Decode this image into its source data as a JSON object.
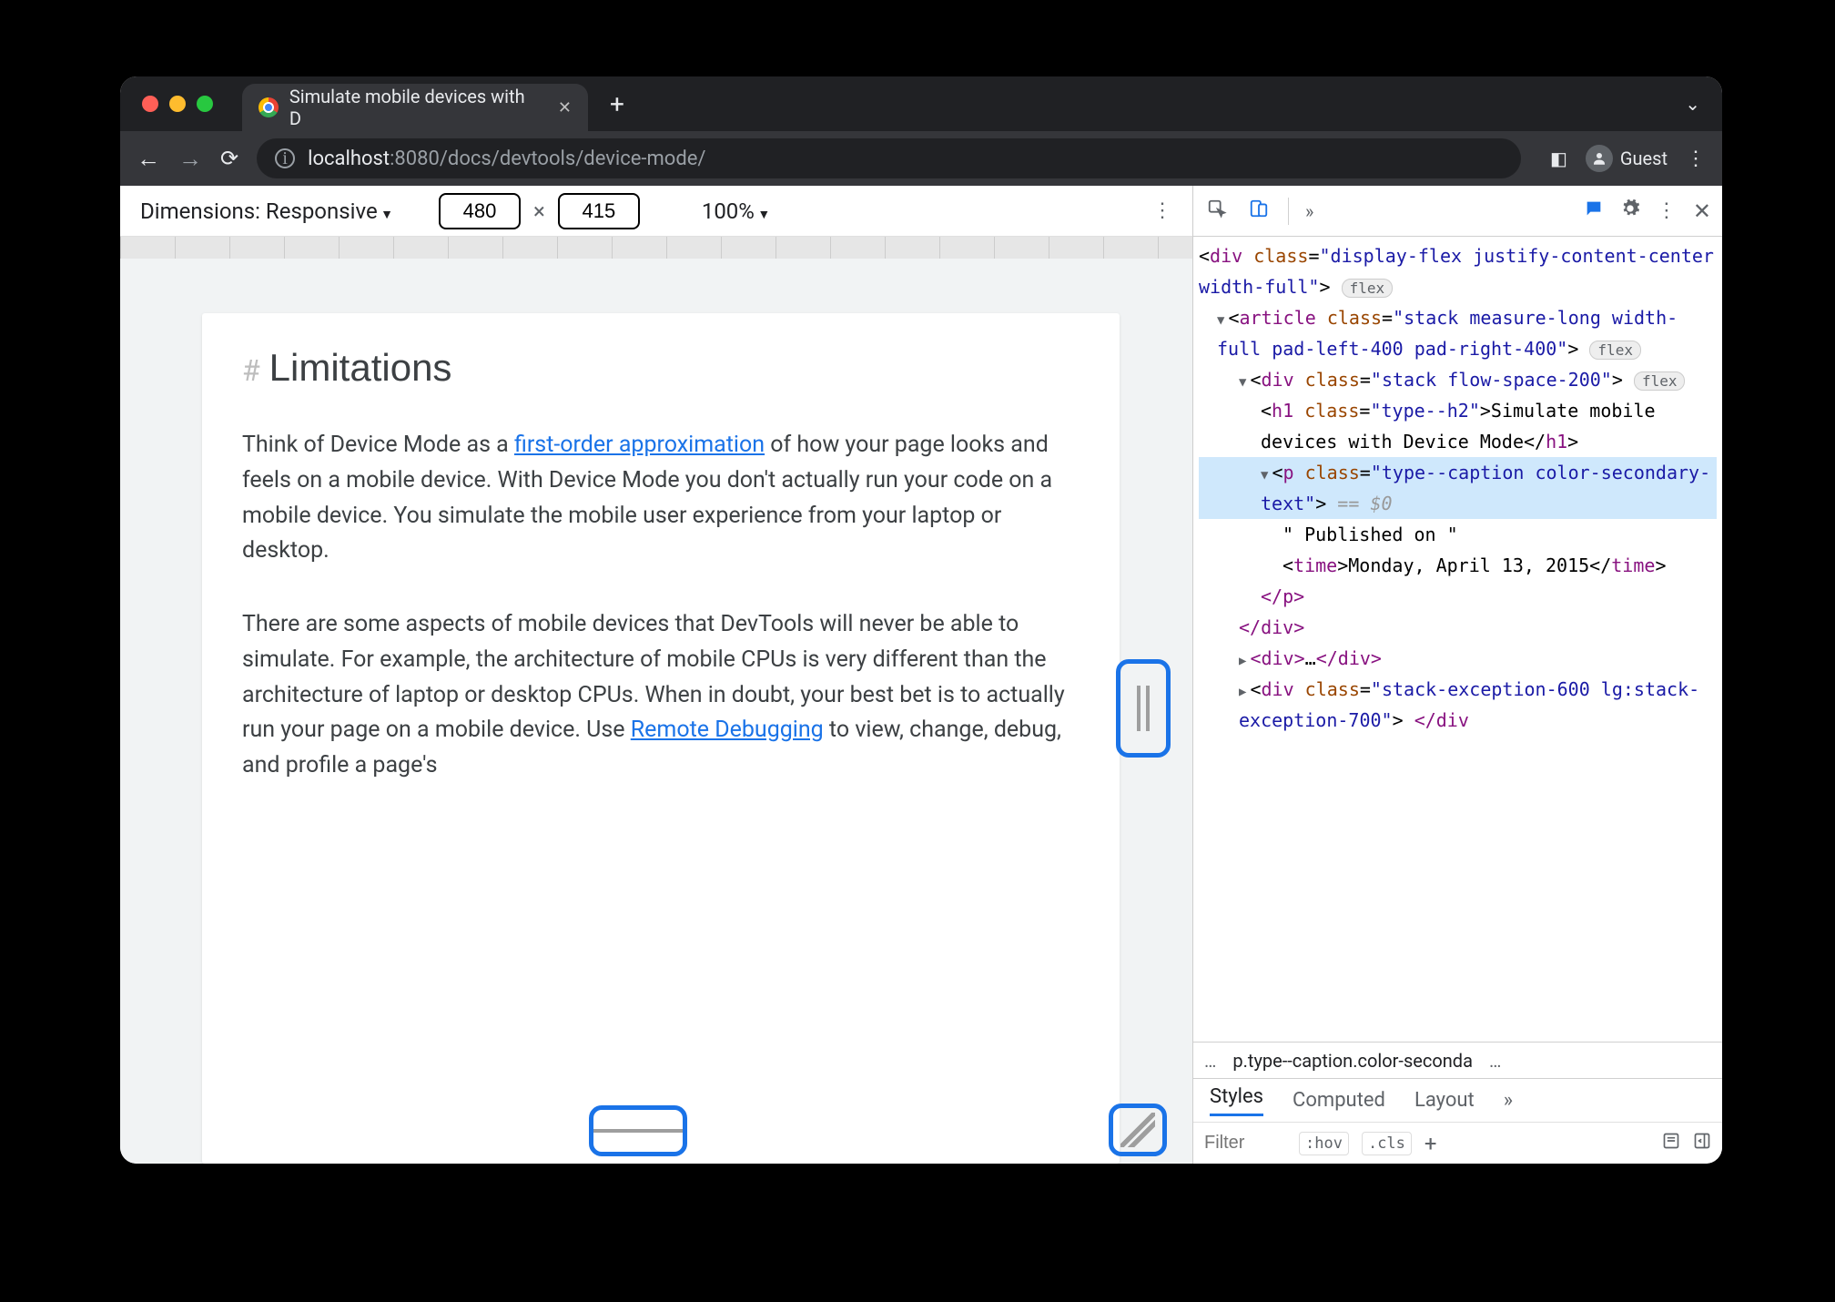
{
  "browser": {
    "tab_title": "Simulate mobile devices with D",
    "new_tab_glyph": "+",
    "chevron": "⌄",
    "url_host": "localhost",
    "url_port": ":8080",
    "url_path": "/docs/devtools/device-mode/",
    "profile_label": "Guest"
  },
  "device_toolbar": {
    "dimensions_label": "Dimensions: Responsive",
    "width": "480",
    "height": "415",
    "times": "×",
    "zoom": "100%"
  },
  "page": {
    "heading_hash": "#",
    "heading": "Limitations",
    "p1_a": "Think of Device Mode as a ",
    "p1_link": "first-order approximation",
    "p1_b": " of how your page looks and feels on a mobile device. With Device Mode you don't actually run your code on a mobile device. You simulate the mobile user experience from your laptop or desktop.",
    "p2_a": "There are some aspects of mobile devices that DevTools will never be able to simulate. For example, the architecture of mobile CPUs is very different than the architecture of laptop or desktop CPUs. When in doubt, your best bet is to actually run your page on a mobile device. Use ",
    "p2_link": "Remote Debugging",
    "p2_b": " to view, change, debug, and profile a page's"
  },
  "elements": {
    "l1": {
      "tag": "div",
      "attr": "class",
      "val": "display-flex justify-content-center width-full",
      "badge": "flex"
    },
    "l2": {
      "tag": "article",
      "attr": "class",
      "val": "stack measure-long width-full pad-left-400 pad-right-400",
      "badge": "flex"
    },
    "l3": {
      "tag": "div",
      "attr": "class",
      "val": "stack flow-space-200",
      "badge": "flex"
    },
    "l4": {
      "tag": "h1",
      "attr": "class",
      "val": "type--h2",
      "text": "Simulate mobile devices with Device Mode"
    },
    "l5": {
      "tag": "p",
      "attr": "class",
      "val": "type--caption color-secondary-text",
      "eq": " == ",
      "dollar": "$0"
    },
    "l6": {
      "text": "\" Published on \""
    },
    "l7": {
      "tag": "time",
      "text": "Monday, April 13, 2015"
    },
    "l8": {
      "close_p": "</p>"
    },
    "l9": {
      "close_div": "</div>"
    },
    "l10": {
      "collapsed_div": "…",
      "open": "<div>",
      "close": "</div>"
    },
    "l11": {
      "tag": "div",
      "attr": "class",
      "val": "stack-exception-600 lg:stack-exception-700",
      "close": "</div"
    }
  },
  "breadcrumb": {
    "left": "…",
    "mid": "p.type--caption.color-seconda",
    "right": "…"
  },
  "styles": {
    "tab1": "Styles",
    "tab2": "Computed",
    "tab3": "Layout",
    "more": "»",
    "filter_ph": "Filter",
    "hov": ":hov",
    "cls": ".cls",
    "plus": "+"
  }
}
